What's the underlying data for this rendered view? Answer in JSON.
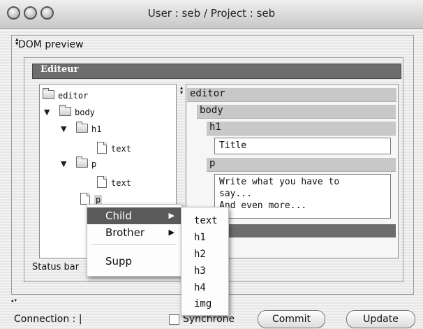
{
  "window": {
    "title": "User : seb / Project : seb"
  },
  "dom_preview": {
    "label": "DOM preview"
  },
  "editor_panel": {
    "title": "Editeur"
  },
  "tree": {
    "nodes": [
      {
        "label": "editor",
        "type": "folder",
        "expanded": false
      },
      {
        "label": "body",
        "type": "folder",
        "expanded": true
      },
      {
        "label": "h1",
        "type": "folder",
        "expanded": true
      },
      {
        "label": "text",
        "type": "document"
      },
      {
        "label": "p",
        "type": "folder",
        "expanded": true
      },
      {
        "label": "text",
        "type": "document"
      },
      {
        "label": "p",
        "type": "document",
        "selected": true
      }
    ]
  },
  "preview": {
    "editor": "editor",
    "body": "body",
    "h1": "h1",
    "h1_value": "Title",
    "p": "p",
    "p_value_line1": "Write what you have to",
    "p_value_line2": "say...",
    "p_value_line3": "And even more..."
  },
  "status_bar": {
    "label": "Status bar"
  },
  "context_menu": {
    "items": [
      {
        "label": "Child",
        "has_submenu": true,
        "highlighted": true
      },
      {
        "label": "Brother",
        "has_submenu": true
      },
      {
        "label": "Supp"
      }
    ],
    "submenu_items": [
      "text",
      "h1",
      "h2",
      "h3",
      "h4",
      "img"
    ]
  },
  "footer": {
    "connection_label": "Connection : |",
    "synchrone_label": "Synchrone",
    "commit_label": "Commit",
    "update_label": "Update"
  },
  "icons": {
    "arrow": "▶",
    "tri_down": "▼"
  },
  "colors": {
    "header_bar": "#6d6d6d",
    "menu_highlight": "#5a5a5a",
    "preview_header": "#c8c8c8"
  }
}
